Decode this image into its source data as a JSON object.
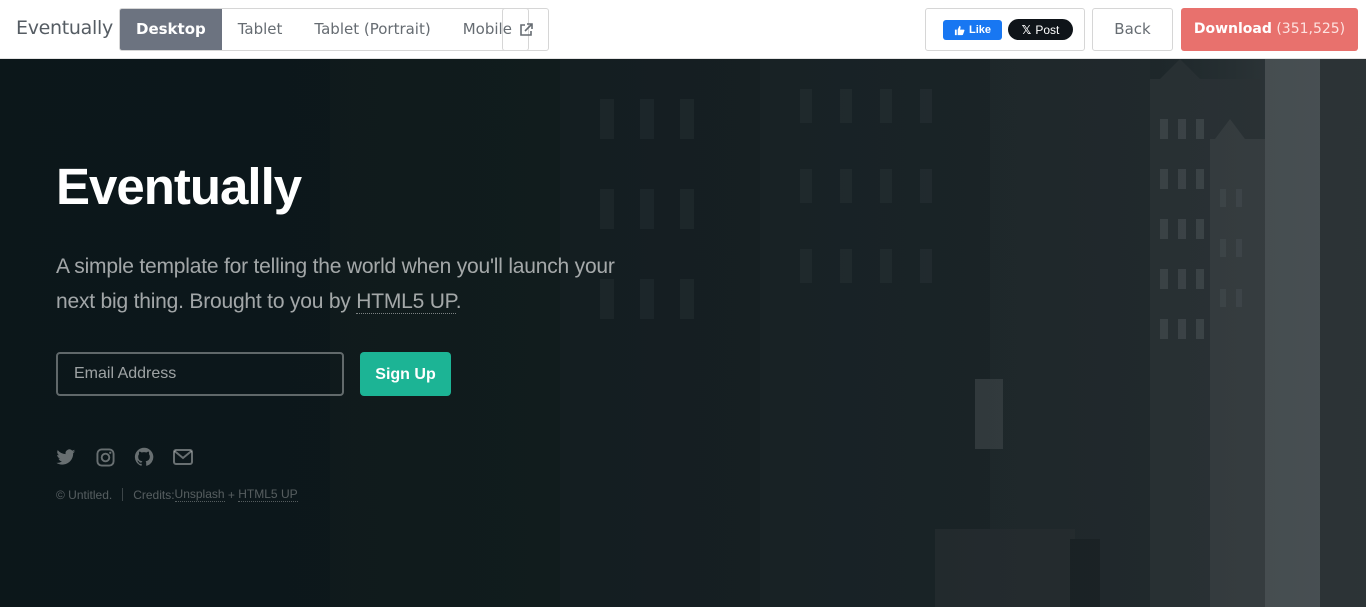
{
  "toolbar": {
    "brand": "Eventually",
    "devices": [
      "Desktop",
      "Tablet",
      "Tablet (Portrait)",
      "Mobile"
    ],
    "active_device": "Desktop",
    "facebook_like": "Like",
    "x_post": "Post",
    "back": "Back",
    "download_label": "Download",
    "download_count": "(351,525)"
  },
  "hero": {
    "title": "Eventually",
    "desc_text": "A simple template for telling the world when you'll launch your next big thing. Brought to you by ",
    "desc_link": "HTML5 UP",
    "desc_end": ".",
    "email_placeholder": "Email Address",
    "signup": "Sign Up",
    "social_icons": [
      "twitter-icon",
      "instagram-icon",
      "github-icon",
      "envelope-icon"
    ],
    "copyright": "© Untitled.",
    "credits_prefix": "Credits: ",
    "credits_link1": "Unsplash",
    "credits_plus": " + ",
    "credits_link2": "HTML5 UP"
  },
  "colors": {
    "download": "#e8716d",
    "signup": "#1cb495",
    "active_tab": "#6c7380",
    "facebook": "#1877f2"
  }
}
